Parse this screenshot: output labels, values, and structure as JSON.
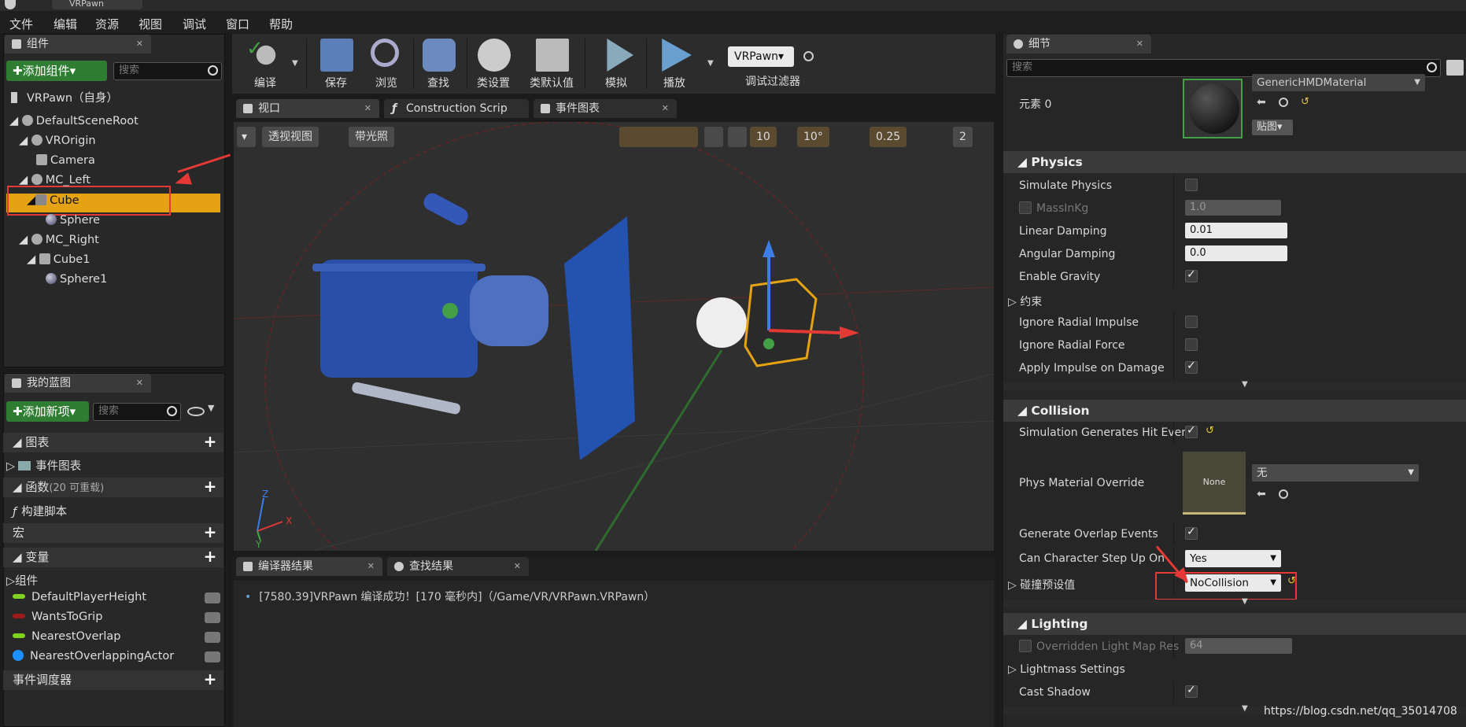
{
  "window": {
    "tab_title": "VRPawn"
  },
  "menu": [
    "文件",
    "编辑",
    "资源",
    "视图",
    "调试",
    "窗口",
    "帮助"
  ],
  "components_panel": {
    "tab": "组件",
    "add_button": "✚添加组件▾",
    "search_placeholder": "搜索",
    "self_label": "VRPawn（自身）",
    "tree": [
      {
        "label": "DefaultSceneRoot"
      },
      {
        "label": "VROrigin"
      },
      {
        "label": "Camera"
      },
      {
        "label": "MC_Left"
      },
      {
        "label": "Cube"
      },
      {
        "label": "Sphere"
      },
      {
        "label": "MC_Right"
      },
      {
        "label": "Cube1"
      },
      {
        "label": "Sphere1"
      }
    ]
  },
  "myblueprint": {
    "tab": "我的蓝图",
    "add_button": "✚添加新项▾",
    "search_placeholder": "搜索",
    "sections": {
      "graphs": "图表",
      "event_graph": "事件图表",
      "functions": "函数",
      "functions_note": "(20 可重载)",
      "construction": "构建脚本",
      "macros": "宏",
      "variables": "变量",
      "components": "组件",
      "dispatchers": "事件调度器"
    },
    "variables": [
      {
        "name": "DefaultPlayerHeight",
        "color": "#7ed321"
      },
      {
        "name": "WantsToGrip",
        "color": "#9b1b1b"
      },
      {
        "name": "NearestOverlap",
        "color": "#7ed321"
      },
      {
        "name": "NearestOverlappingActor",
        "color": "#1e90ff"
      }
    ]
  },
  "toolbar": {
    "compile": "编译",
    "save": "保存",
    "browse": "浏览",
    "find": "查找",
    "class_settings": "类设置",
    "class_defaults": "类默认值",
    "simulate": "模拟",
    "play": "播放",
    "debug_object": "VRPawn▾",
    "debug_filter": "调试过滤器"
  },
  "editor_tabs": {
    "viewport": "视口",
    "construction": "Construction Scrip",
    "event_graph": "事件图表"
  },
  "viewport": {
    "perspective": "透视视图",
    "lit": "带光照",
    "grid_value": "10",
    "rot_value": "10°",
    "scale_value": "0.25",
    "speed_value": "2",
    "axis_x": "X",
    "axis_y": "Y",
    "axis_z": "Z"
  },
  "bottom": {
    "tab_compiler": "编译器结果",
    "tab_find": "查找结果",
    "log_line": "[7580.39]VRPawn 编译成功！[170 毫秒内]（/Game/VR/VRPawn.VRPawn）"
  },
  "details": {
    "tab": "细节",
    "search_placeholder": "搜索",
    "element_label": "元素 0",
    "material_name": "GenericHMDMaterial",
    "texture_btn": "贴图▾",
    "physics": {
      "title": "Physics",
      "simulate": "Simulate Physics",
      "mass": "MassInKg",
      "mass_val": "1.0",
      "linear": "Linear Damping",
      "linear_val": "0.01",
      "angular": "Angular Damping",
      "angular_val": "0.0",
      "gravity": "Enable Gravity",
      "constraints": "约束",
      "ign_imp": "Ignore Radial Impulse",
      "ign_force": "Ignore Radial Force",
      "apply_imp": "Apply Impulse on Damage"
    },
    "collision": {
      "title": "Collision",
      "hit_events": "Simulation Generates Hit Ever",
      "phys_mat": "Phys Material Override",
      "phys_mat_thumb": "None",
      "phys_mat_val": "无",
      "overlap": "Generate Overlap Events",
      "step_up": "Can Character Step Up On",
      "step_up_val": "Yes",
      "preset": "碰撞预设值",
      "preset_val": "NoCollision"
    },
    "lighting": {
      "title": "Lighting",
      "overridden": "Overridden Light Map Res",
      "overridden_val": "64",
      "lightmass": "Lightmass Settings",
      "cast_shadow": "Cast Shadow"
    }
  },
  "watermark": "https://blog.csdn.net/qq_35014708"
}
